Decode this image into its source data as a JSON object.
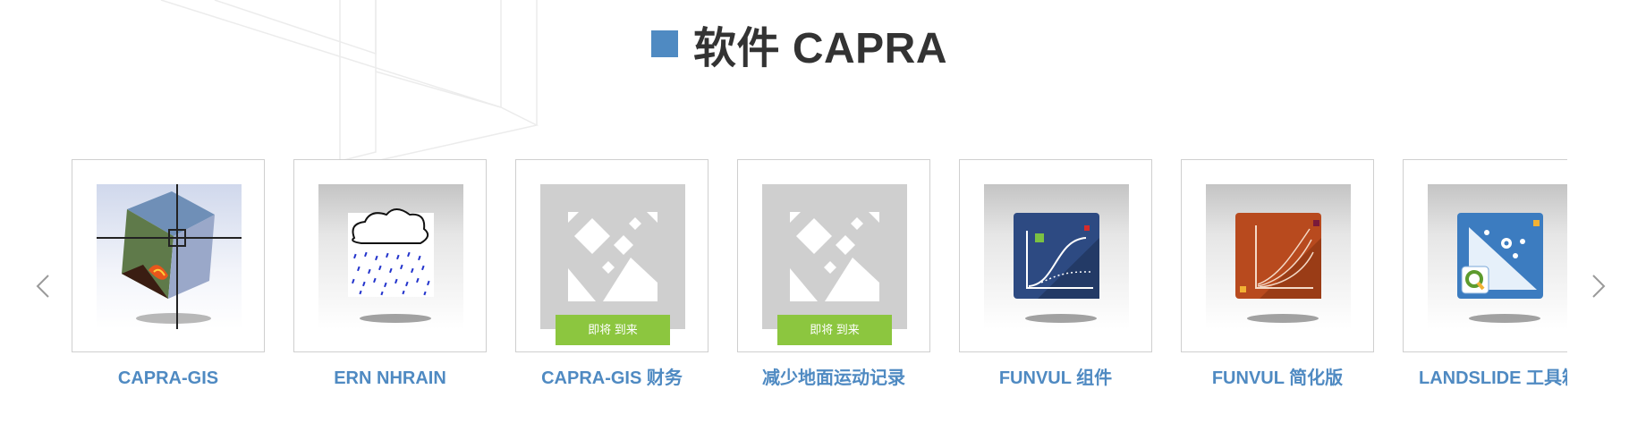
{
  "section": {
    "title": "软件 CAPRA",
    "accent_color": "#4f8ac2"
  },
  "carousel": {
    "prev_icon": "chevron-left-icon",
    "next_icon": "chevron-right-icon",
    "soon_badge_color": "#8cc63f",
    "items": [
      {
        "label": "CAPRA-GIS",
        "icon": "globe-cube-crosshair-icon"
      },
      {
        "label": "ERN NHRAIN",
        "icon": "rain-cloud-icon"
      },
      {
        "label": "CAPRA-GIS 财务",
        "icon": "image-placeholder-icon",
        "badge": "即将 到来"
      },
      {
        "label": "减少地面运动记录",
        "icon": "image-placeholder-icon",
        "badge": "即将 到来"
      },
      {
        "label": "FUNVUL 组件",
        "icon": "vulnerability-curve-icon"
      },
      {
        "label": "FUNVUL 简化版",
        "icon": "vulnerability-curves-icon"
      },
      {
        "label": "LANDSLIDE 工具箱",
        "icon": "qgis-landslide-icon"
      }
    ]
  }
}
